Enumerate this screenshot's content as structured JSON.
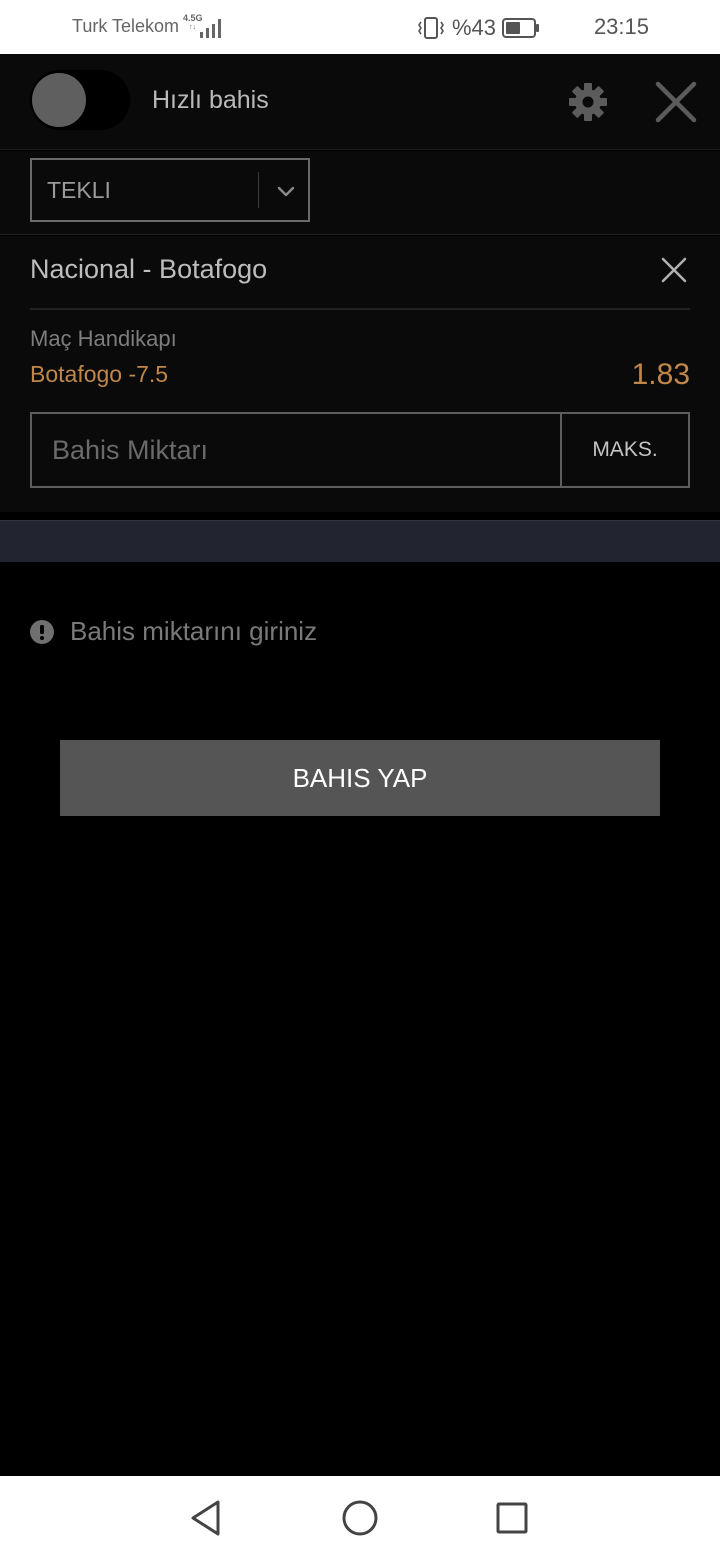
{
  "status_bar": {
    "carrier": "Turk Telekom",
    "network_top": "4.5G",
    "network_bottom": "↑↓",
    "battery_percent": "%43",
    "time": "23:15"
  },
  "header": {
    "title": "Hızlı bahis",
    "quick_bet_enabled": false
  },
  "bet_type": {
    "selected": "TEKLI"
  },
  "bet": {
    "match": "Nacional - Botafogo",
    "market": "Maç Handikapı",
    "selection": "Botafogo -7.5",
    "odds": "1.83",
    "stake_placeholder": "Bahis Miktarı",
    "stake_value": "",
    "max_label": "MAKS."
  },
  "warning": {
    "text": "Bahis miktarını giriniz"
  },
  "place_bet": {
    "label": "BAHIS YAP"
  },
  "colors": {
    "accent": "#c0874a",
    "button": "#555555",
    "band": "#22252f"
  }
}
